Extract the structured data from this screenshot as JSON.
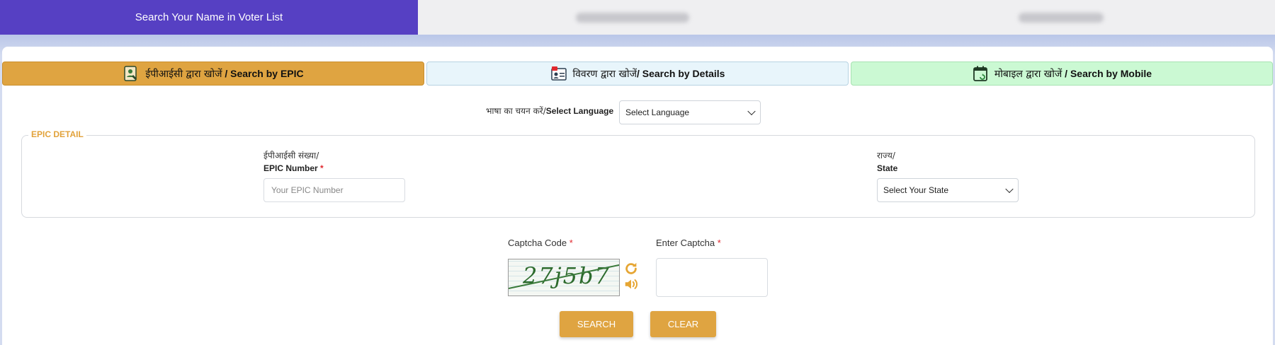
{
  "top_tabs": {
    "active_label": "Search Your Name in Voter List"
  },
  "mode_tabs": {
    "epic": {
      "hindi": "ईपीआईसी द्वारा खोजें",
      "english": " / Search by EPIC",
      "icon": "id-card-icon"
    },
    "details": {
      "hindi": "विवरण द्वारा खोजें",
      "english": "/ Search by Details",
      "icon": "details-card-icon"
    },
    "mobile": {
      "hindi": "मोबाइल द्वारा खोजें",
      "english": " / Search by Mobile",
      "icon": "mobile-calendar-icon"
    }
  },
  "language": {
    "label_hindi": "भाषा का चयन करें/",
    "label_english": "Select Language",
    "selected": "Select Language"
  },
  "epic_detail": {
    "legend": "EPIC DETAIL",
    "epic_label_hindi": "ईपीआईसी संख्या/",
    "epic_label_english": "EPIC Number",
    "required_mark": "*",
    "epic_placeholder": "Your EPIC Number",
    "state_label_hindi": "राज्य/",
    "state_label_english": "State",
    "state_selected": "Select Your State"
  },
  "captcha": {
    "code_label": "Captcha Code",
    "enter_label": "Enter Captcha",
    "required_mark": "*",
    "code_text": "27j5b7",
    "refresh_icon": "refresh-icon",
    "audio_icon": "speaker-icon"
  },
  "buttons": {
    "search": "SEARCH",
    "clear": "CLEAR"
  },
  "colors": {
    "header_active": "#5640c3",
    "accent": "#dfa441",
    "details_tab": "#e8f5fb",
    "mobile_tab": "#cbf9d3",
    "required": "#e0282e"
  }
}
